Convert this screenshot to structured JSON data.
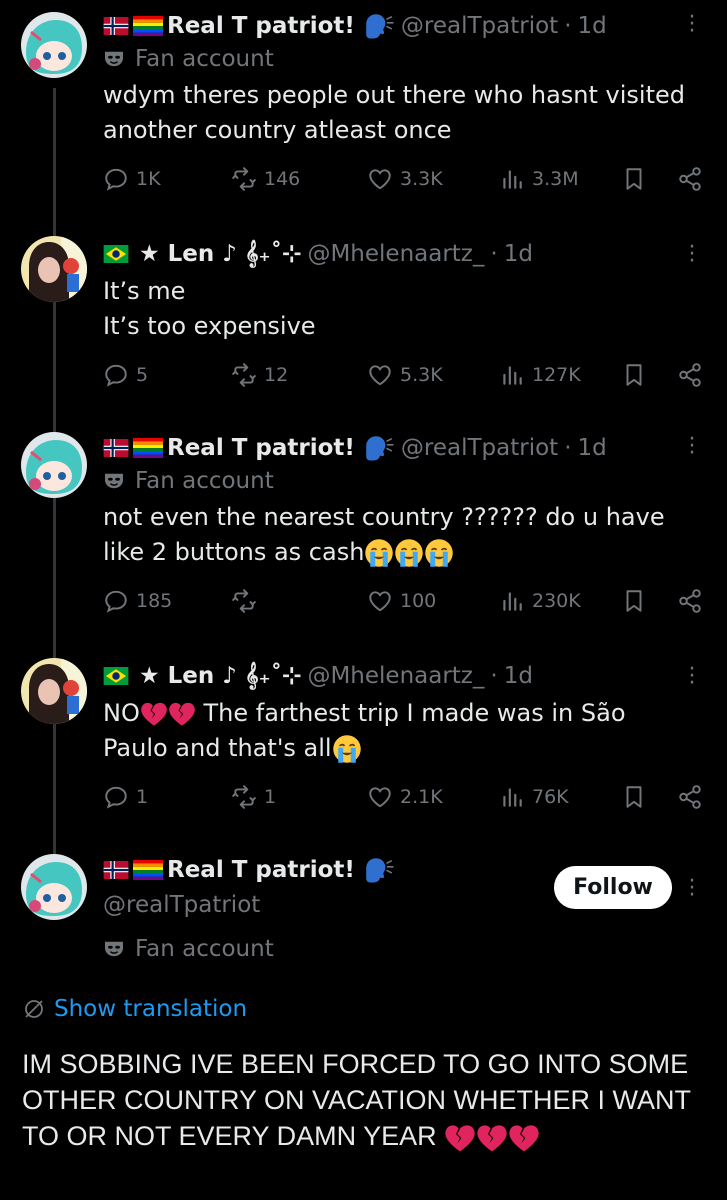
{
  "tweets": [
    {
      "name": "Real T patriot!",
      "handle": "@realTpatriot",
      "time": "1d",
      "badge": "Fan account",
      "text": "wdym theres people out there who hasnt visited another country atleast once",
      "replies": "1K",
      "retweets": "146",
      "likes": "3.3K",
      "views": "3.3M"
    },
    {
      "name": "★ Len ♪ 𝄞₊˚⊹",
      "handle": "@Mhelenaartz_",
      "time": "1d",
      "text_line1": "It’s me",
      "text_line2": "It’s too expensive",
      "replies": "5",
      "retweets": "12",
      "likes": "5.3K",
      "views": "127K"
    },
    {
      "name": "Real T patriot!",
      "handle": "@realTpatriot",
      "time": "1d",
      "badge": "Fan account",
      "text": "not even the nearest country ?????? do u have like 2 buttons as cash",
      "replies": "185",
      "retweets": "",
      "likes": "100",
      "views": "230K"
    },
    {
      "name": "★ Len ♪ 𝄞₊˚⊹",
      "handle": "@Mhelenaartz_",
      "time": "1d",
      "text_a": "NO",
      "text_b": " The farthest trip I made was in São Paulo and that's all",
      "replies": "1",
      "retweets": "1",
      "likes": "2.1K",
      "views": "76K"
    }
  ],
  "main_post": {
    "name": "Real T patriot!",
    "handle": "@realTpatriot",
    "badge": "Fan account",
    "follow_label": "Follow",
    "translation_label": "Show translation",
    "text": "IM SOBBING IVE BEEN FORCED TO GO INTO SOME OTHER COUNTRY ON VACATION WHETHER I WANT TO OR NOT EVERY DAMN YEAR"
  },
  "colors": {
    "background": "#000000",
    "text": "#e7e9ea",
    "muted": "#71767b",
    "link": "#1d9bf0"
  }
}
